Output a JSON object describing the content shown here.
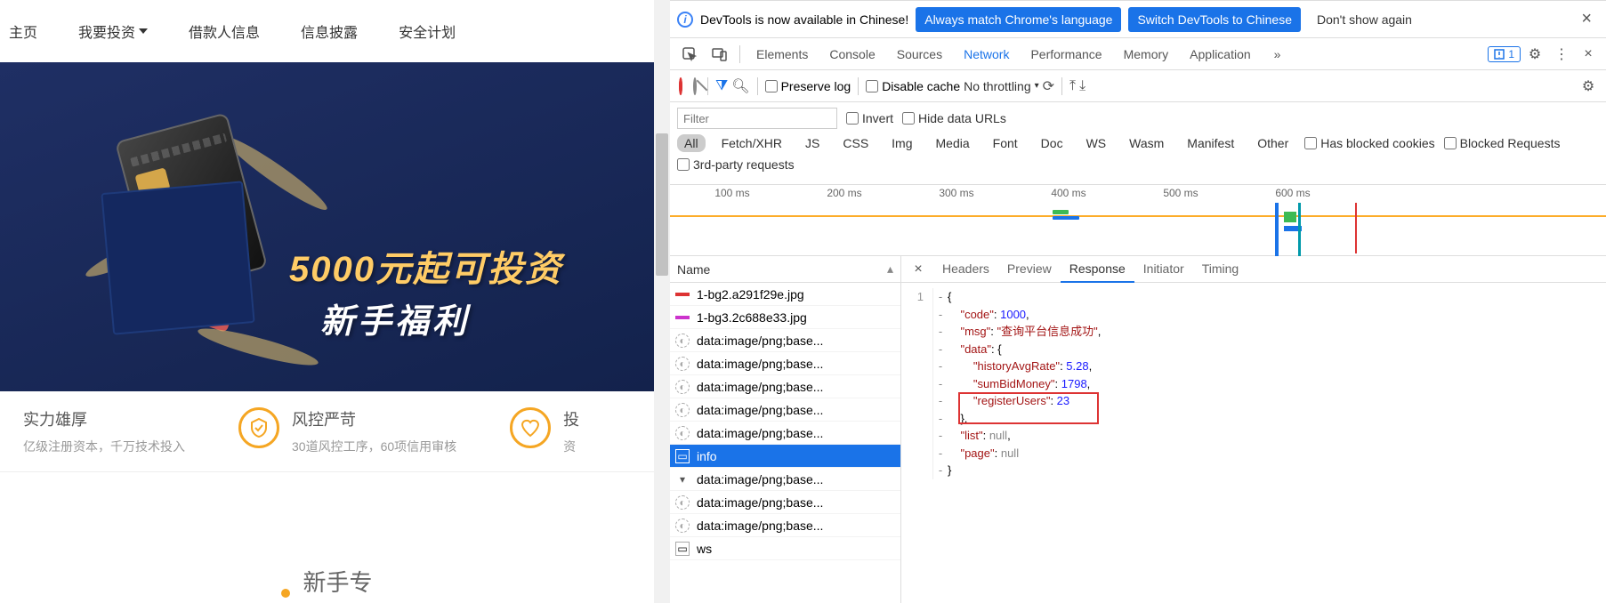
{
  "nav": [
    "主页",
    "我要投资",
    "借款人信息",
    "信息披露",
    "安全计划"
  ],
  "hero": {
    "title": "5000元起可投资",
    "subtitle": "新手福利"
  },
  "features": [
    {
      "title": "实力雄厚",
      "desc": "亿级注册资本，千万技术投入"
    },
    {
      "title": "风控严苛",
      "desc": "30道风控工序，60项信用审核"
    },
    {
      "title": "投",
      "desc": "资"
    }
  ],
  "footer": "新手专",
  "infobar": {
    "text": "DevTools is now available in Chinese!",
    "btn1": "Always match Chrome's language",
    "btn2": "Switch DevTools to Chinese",
    "btn3": "Don't show again"
  },
  "tabs": [
    "Elements",
    "Console",
    "Sources",
    "Network",
    "Performance",
    "Memory",
    "Application"
  ],
  "tabs_active": 3,
  "tabs_badge": "1",
  "toolbar": {
    "preserve": "Preserve log",
    "disable": "Disable cache",
    "throttle": "No throttling"
  },
  "filters": {
    "placeholder": "Filter",
    "invert": "Invert",
    "hide": "Hide data URLs",
    "types": [
      "All",
      "Fetch/XHR",
      "JS",
      "CSS",
      "Img",
      "Media",
      "Font",
      "Doc",
      "WS",
      "Wasm",
      "Manifest",
      "Other"
    ],
    "blocked_cookies": "Has blocked cookies",
    "blocked_req": "Blocked Requests",
    "third": "3rd-party requests"
  },
  "timeline_ticks": [
    "100 ms",
    "200 ms",
    "300 ms",
    "400 ms",
    "500 ms",
    "600 ms"
  ],
  "reqlist_header": "Name",
  "requests": [
    {
      "icon": "img-red",
      "name": "1-bg2.a291f29e.jpg"
    },
    {
      "icon": "img-purple",
      "name": "1-bg3.2c688e33.jpg"
    },
    {
      "icon": "data",
      "name": "data:image/png;base..."
    },
    {
      "icon": "data",
      "name": "data:image/png;base..."
    },
    {
      "icon": "data",
      "name": "data:image/png;base..."
    },
    {
      "icon": "data",
      "name": "data:image/png;base..."
    },
    {
      "icon": "data",
      "name": "data:image/png;base..."
    },
    {
      "icon": "doc",
      "name": "info",
      "selected": true
    },
    {
      "icon": "tri",
      "name": "data:image/png;base..."
    },
    {
      "icon": "data",
      "name": "data:image/png;base..."
    },
    {
      "icon": "data",
      "name": "data:image/png;base..."
    },
    {
      "icon": "ws",
      "name": "ws"
    }
  ],
  "detail_tabs": [
    "Headers",
    "Preview",
    "Response",
    "Initiator",
    "Timing"
  ],
  "detail_active": 2,
  "response": {
    "code": 1000,
    "msg": "查询平台信息成功",
    "data": {
      "historyAvgRate": 5.28,
      "sumBidMoney": 1798.0,
      "registerUsers": 23
    },
    "list": "null",
    "page": "null"
  }
}
